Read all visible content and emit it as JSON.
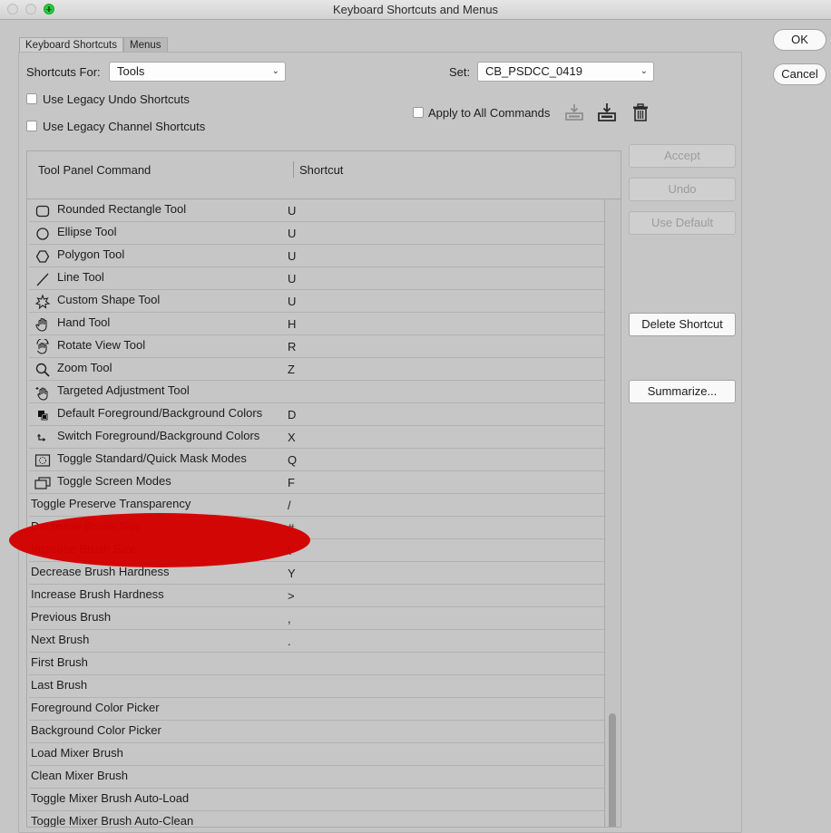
{
  "window": {
    "title": "Keyboard Shortcuts and Menus"
  },
  "tabs": [
    {
      "label": "Keyboard Shortcuts"
    },
    {
      "label": "Menus"
    }
  ],
  "shortcuts_for": {
    "label": "Shortcuts For:",
    "value": "Tools"
  },
  "set": {
    "label": "Set:",
    "value": "CB_PSDCC_0419"
  },
  "options": {
    "legacy_undo": "Use Legacy Undo Shortcuts",
    "legacy_channel": "Use Legacy Channel Shortcuts",
    "apply_all": "Apply to All Commands"
  },
  "table": {
    "col_command": "Tool Panel Command",
    "col_shortcut": "Shortcut",
    "rows": [
      {
        "name": "Rounded Rectangle Tool",
        "key": "U",
        "icon": "rounded-rectangle-icon"
      },
      {
        "name": "Ellipse Tool",
        "key": "U",
        "icon": "ellipse-icon"
      },
      {
        "name": "Polygon Tool",
        "key": "U",
        "icon": "polygon-icon"
      },
      {
        "name": "Line Tool",
        "key": "U",
        "icon": "line-icon"
      },
      {
        "name": "Custom Shape Tool",
        "key": "U",
        "icon": "custom-shape-icon"
      },
      {
        "name": "Hand Tool",
        "key": "H",
        "icon": "hand-icon"
      },
      {
        "name": "Rotate View Tool",
        "key": "R",
        "icon": "rotate-view-icon"
      },
      {
        "name": "Zoom Tool",
        "key": "Z",
        "icon": "zoom-icon"
      },
      {
        "name": "Targeted Adjustment Tool",
        "key": "",
        "icon": "targeted-adjustment-icon"
      },
      {
        "name": "Default Foreground/Background Colors",
        "key": "D",
        "icon": "default-colors-icon"
      },
      {
        "name": "Switch Foreground/Background Colors",
        "key": "X",
        "icon": "switch-colors-icon"
      },
      {
        "name": "Toggle Standard/Quick Mask Modes",
        "key": "Q",
        "icon": "quick-mask-icon"
      },
      {
        "name": "Toggle Screen Modes",
        "key": "F",
        "icon": "screen-modes-icon"
      },
      {
        "name": "Toggle Preserve Transparency",
        "key": "/",
        "icon": ""
      },
      {
        "name": "Decrease Brush Size",
        "key": "#",
        "icon": ""
      },
      {
        "name": "Increase Brush Size",
        "key": "\\",
        "icon": ""
      },
      {
        "name": "Decrease Brush Hardness",
        "key": "Y",
        "icon": ""
      },
      {
        "name": "Increase Brush Hardness",
        "key": ">",
        "icon": ""
      },
      {
        "name": "Previous Brush",
        "key": ",",
        "icon": ""
      },
      {
        "name": "Next Brush",
        "key": ".",
        "icon": ""
      },
      {
        "name": "First Brush",
        "key": "",
        "icon": ""
      },
      {
        "name": "Last Brush",
        "key": "",
        "icon": ""
      },
      {
        "name": "Foreground Color Picker",
        "key": "",
        "icon": ""
      },
      {
        "name": "Background Color Picker",
        "key": "",
        "icon": ""
      },
      {
        "name": "Load Mixer Brush",
        "key": "",
        "icon": ""
      },
      {
        "name": "Clean Mixer Brush",
        "key": "",
        "icon": ""
      },
      {
        "name": "Toggle Mixer Brush Auto-Load",
        "key": "",
        "icon": ""
      },
      {
        "name": "Toggle Mixer Brush Auto-Clean",
        "key": "",
        "icon": ""
      }
    ]
  },
  "buttons": {
    "ok": "OK",
    "cancel": "Cancel",
    "accept": "Accept",
    "undo": "Undo",
    "use_default": "Use Default",
    "delete_shortcut": "Delete Shortcut",
    "summarize": "Summarize..."
  },
  "colors": {
    "highlight": "#d40000",
    "maximize": "#28c940"
  }
}
